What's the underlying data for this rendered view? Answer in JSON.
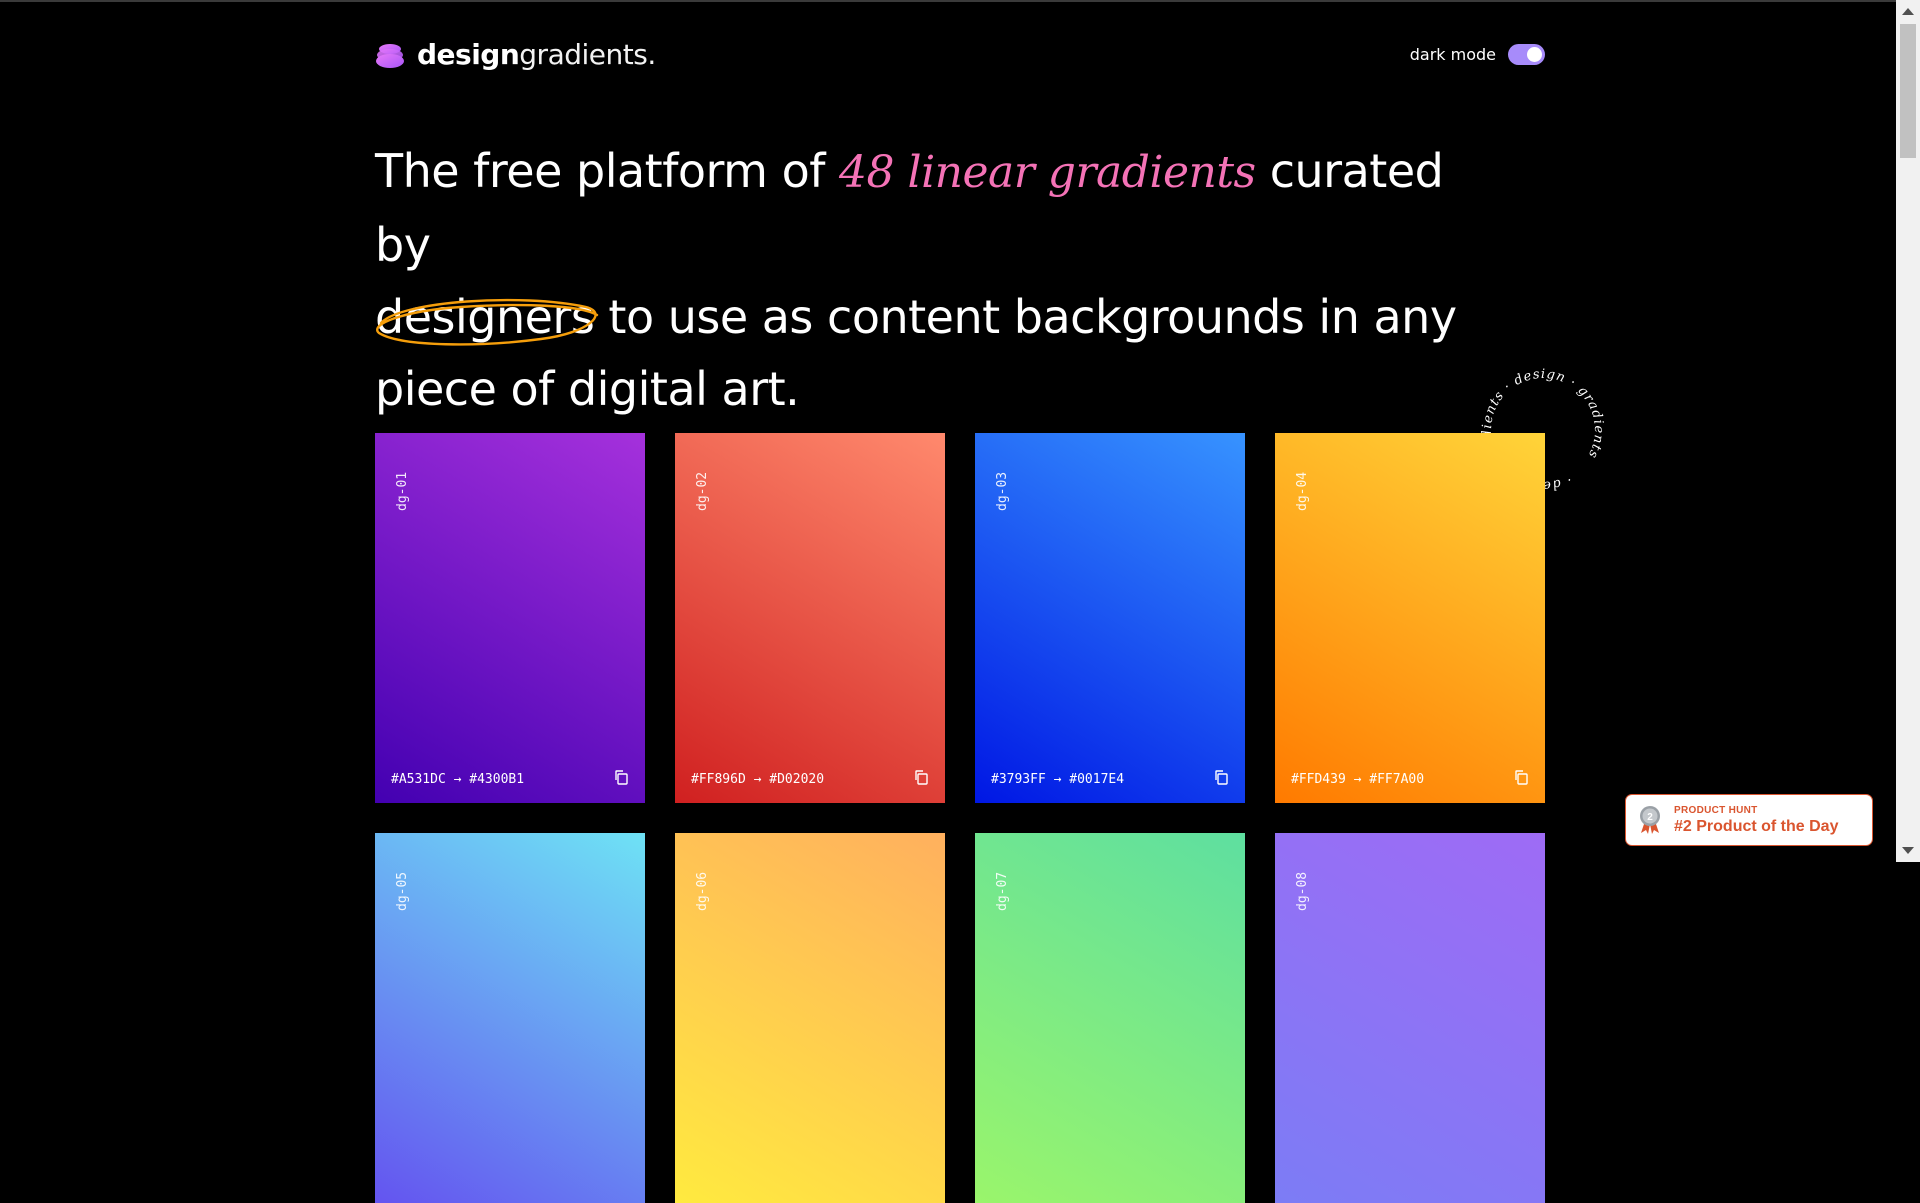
{
  "header": {
    "logo_bold": "design",
    "logo_light": "gradients.",
    "dark_mode_label": "dark mode",
    "dark_mode_on": true
  },
  "hero": {
    "part1": "The free platform of ",
    "accent": "48 linear gradients",
    "part2": " curated by",
    "circled_word": "designers",
    "part3": " to use as content backgrounds in any piece of digital art."
  },
  "badge_ring_text": "· design · gradients · design · gradients ",
  "cards": [
    {
      "id": "dg-01",
      "from": "#A531DC",
      "to": "#4300B1",
      "label": "#A531DC → #4300B1"
    },
    {
      "id": "dg-02",
      "from": "#FF896D",
      "to": "#D02020",
      "label": "#FF896D → #D02020"
    },
    {
      "id": "dg-03",
      "from": "#3793FF",
      "to": "#0017E4",
      "label": "#3793FF → #0017E4"
    },
    {
      "id": "dg-04",
      "from": "#FFD439",
      "to": "#FF7A00",
      "label": "#FFD439 → #FF7A00"
    },
    {
      "id": "dg-05",
      "from": "#6EE2F5",
      "to": "#6454F0",
      "label": ""
    },
    {
      "id": "dg-06",
      "from": "#FFB05E",
      "to": "#FFEA3F",
      "label": ""
    },
    {
      "id": "dg-07",
      "from": "#5EDFA0",
      "to": "#9AF56B",
      "label": ""
    },
    {
      "id": "dg-08",
      "from": "#9E6BF5",
      "to": "#7C7CF5",
      "label": ""
    }
  ],
  "product_hunt": {
    "small": "PRODUCT HUNT",
    "big": "#2 Product of the Day",
    "rank": "2"
  },
  "colors": {
    "accent_pink": "#f472b6",
    "toggle": "#a78bfa",
    "scribble": "#f59e0b",
    "product_hunt": "#da552f"
  }
}
